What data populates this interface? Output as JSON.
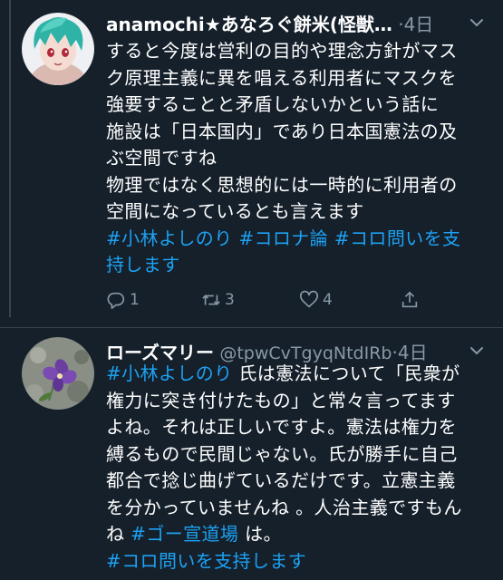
{
  "colors": {
    "background": "#15202b",
    "text": "#ffffff",
    "muted": "#8899a6",
    "link": "#1da1f2",
    "divider": "#38444d"
  },
  "tweets": [
    {
      "display_name": "anamochi★あなろぐ餅米(怪獣…",
      "handle": "",
      "separator": "·",
      "time": "4日",
      "lines": [
        [
          {
            "t": "すると今度は営利の目的や理念方針がマス"
          }
        ],
        [
          {
            "t": "ク原理主義に異を唱える利用者にマスクを"
          }
        ],
        [
          {
            "t": "強要することと矛盾しないかという話に"
          }
        ],
        [
          {
            "t": "施設は「日本国内」であり日本国憲法の及"
          }
        ],
        [
          {
            "t": "ぶ空間ですね"
          }
        ],
        [
          {
            "t": "物理ではなく思想的には一時的に利用者の"
          }
        ],
        [
          {
            "t": "空間になっているとも言えます"
          }
        ],
        [
          {
            "t": "#小林よしのり",
            "h": true
          },
          {
            "t": " "
          },
          {
            "t": "#コロナ論",
            "h": true
          },
          {
            "t": " "
          },
          {
            "t": "#コロ問いを支",
            "h": true
          }
        ],
        [
          {
            "t": "持します",
            "h": true
          }
        ]
      ],
      "actions": {
        "reply_count": "1",
        "retweet_count": "3",
        "like_count": "4",
        "share_icon": "share-icon"
      }
    },
    {
      "display_name": "ローズマリー",
      "handle": "@tpwCvTgyqNtdIRb",
      "separator": "·",
      "time": "4日",
      "lines": [
        [
          {
            "t": "#小林よしのり",
            "h": true
          },
          {
            "t": " 氏は憲法について「民衆が"
          }
        ],
        [
          {
            "t": "権力に突き付けたもの」と常々言ってます"
          }
        ],
        [
          {
            "t": "よね。それは正しいですよ。憲法は権力を"
          }
        ],
        [
          {
            "t": "縛るもので民間じゃない。氏が勝手に自己"
          }
        ],
        [
          {
            "t": "都合で捻じ曲げているだけです。立憲主義"
          }
        ],
        [
          {
            "t": "を分かっていませんね 。人治主義ですもん"
          }
        ],
        [
          {
            "t": "ね "
          },
          {
            "t": "#ゴー宣道場",
            "h": true
          },
          {
            "t": " は。"
          }
        ],
        [
          {
            "t": "#コロ問いを支持します",
            "h": true
          }
        ]
      ]
    }
  ]
}
